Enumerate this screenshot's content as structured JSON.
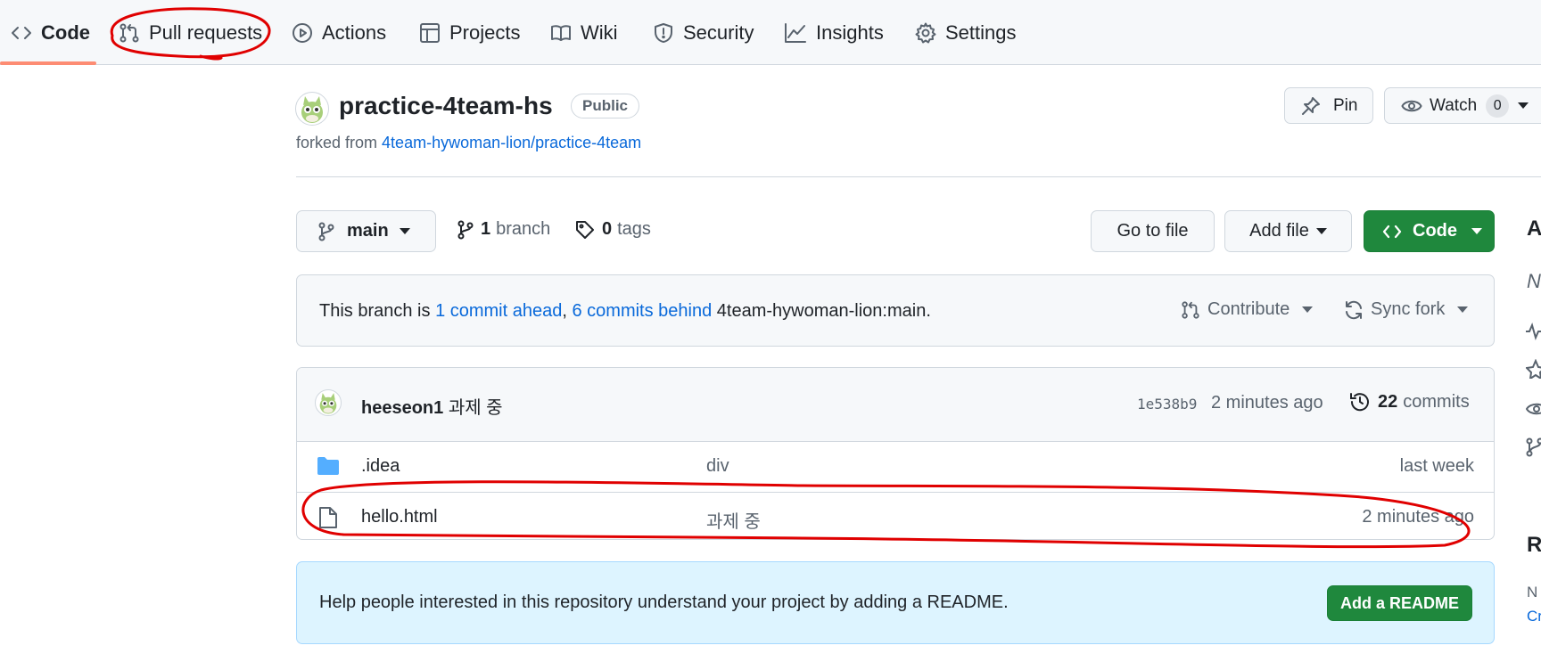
{
  "nav": {
    "tabs": [
      {
        "label": "Code",
        "icon": "code-icon",
        "selected": true
      },
      {
        "label": "Pull requests",
        "icon": "git-pull-request-icon"
      },
      {
        "label": "Actions",
        "icon": "play-icon"
      },
      {
        "label": "Projects",
        "icon": "table-icon"
      },
      {
        "label": "Wiki",
        "icon": "book-icon"
      },
      {
        "label": "Security",
        "icon": "shield-icon"
      },
      {
        "label": "Insights",
        "icon": "graph-icon"
      },
      {
        "label": "Settings",
        "icon": "gear-icon"
      }
    ]
  },
  "repo": {
    "name": "practice-4team-hs",
    "visibility": "Public",
    "forked_prefix": "forked from",
    "forked_from": "4team-hywoman-lion/practice-4team",
    "pin_label": "Pin",
    "watch_label": "Watch",
    "watch_count": "0"
  },
  "toolbar": {
    "branch": "main",
    "branch_count": "1",
    "branch_label": "branch",
    "tag_count": "0",
    "tag_label": "tags",
    "go_to_file": "Go to file",
    "add_file": "Add file",
    "code": "Code"
  },
  "branch_status": {
    "prefix": "This branch is",
    "ahead": "1 commit ahead",
    "separator": ",",
    "behind": "6 commits behind",
    "upstream": "4team-hywoman-lion:main.",
    "contribute": "Contribute",
    "sync_fork": "Sync fork"
  },
  "latest_commit": {
    "author": "heeseon1",
    "message": "과제 중",
    "hash": "1e538b9",
    "time": "2 minutes ago",
    "commit_count": "22",
    "commits_label": "commits"
  },
  "files": [
    {
      "name": ".idea",
      "type": "folder",
      "icon": "folder-icon",
      "message": "div",
      "time": "last week"
    },
    {
      "name": "hello.html",
      "type": "file",
      "icon": "file-icon",
      "message": "과제 중",
      "time": "2 minutes ago"
    }
  ],
  "readme_banner": {
    "text": "Help people interested in this repository understand your project by adding a README.",
    "button": "Add a README"
  },
  "sidebar_partial": {
    "about_initial": "A",
    "desc_initial": "N",
    "readme_initial": "R",
    "readme_line1": "N",
    "readme_line2": "Cr"
  },
  "colors": {
    "accent": "#0969da",
    "primary_button": "#1f883d",
    "annotation": "#e00000",
    "tab_underline": "#fd8c73",
    "folder": "#54aeff"
  }
}
